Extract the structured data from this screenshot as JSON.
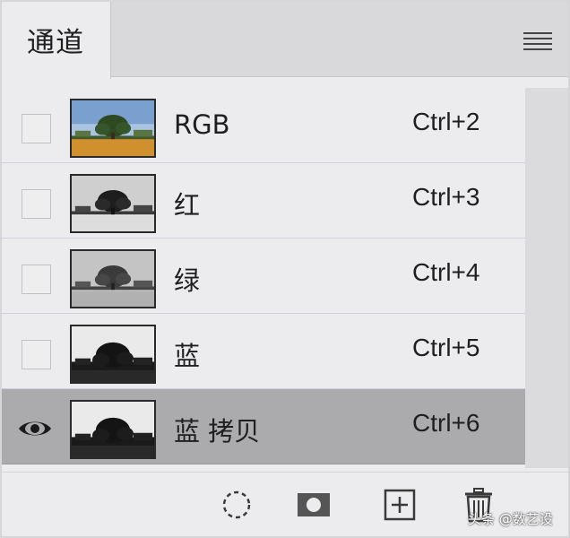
{
  "panel": {
    "tab_title": "通道",
    "menu_icon": "hamburger-menu-icon"
  },
  "channels": [
    {
      "name": "RGB",
      "shortcut": "Ctrl+2",
      "visible": false,
      "thumb": "color"
    },
    {
      "name": "红",
      "shortcut": "Ctrl+3",
      "visible": false,
      "thumb": "gray-light"
    },
    {
      "name": "绿",
      "shortcut": "Ctrl+4",
      "visible": false,
      "thumb": "gray-light"
    },
    {
      "name": "蓝",
      "shortcut": "Ctrl+5",
      "visible": false,
      "thumb": "gray-dark"
    },
    {
      "name": "蓝 拷贝",
      "shortcut": "Ctrl+6",
      "visible": true,
      "selected": true,
      "thumb": "gray-dark"
    }
  ],
  "footer": {
    "buttons": [
      {
        "icon": "load-selection-icon"
      },
      {
        "icon": "save-selection-mask-icon"
      },
      {
        "icon": "new-channel-icon"
      },
      {
        "icon": "trash-icon"
      }
    ],
    "watermark": "头条 @数艺设"
  },
  "colors": {
    "selected_row": "#ababad",
    "panel_bg": "#ececee",
    "tab_bar": "#d9d9db"
  }
}
